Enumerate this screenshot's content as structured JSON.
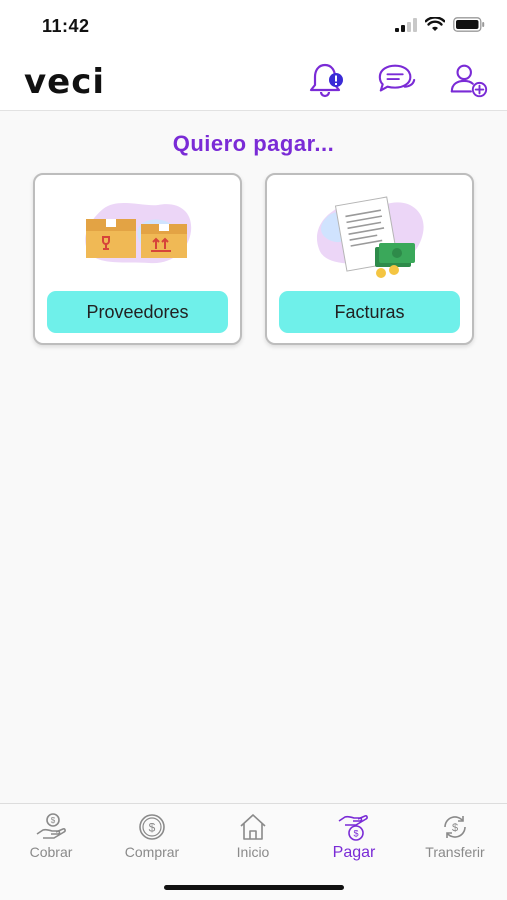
{
  "status_bar": {
    "time": "11:42"
  },
  "header": {
    "logo": "veci",
    "icons": [
      "bell-alert-icon",
      "chat-icon",
      "add-user-icon"
    ]
  },
  "main": {
    "title": "Quiero pagar...",
    "options": [
      {
        "label": "Proveedores",
        "icon": "boxes-illustration"
      },
      {
        "label": "Facturas",
        "icon": "invoice-money-illustration"
      }
    ]
  },
  "bottom_nav": {
    "items": [
      {
        "label": "Cobrar",
        "icon": "hand-coin-icon",
        "active": false
      },
      {
        "label": "Comprar",
        "icon": "coin-icon",
        "active": false
      },
      {
        "label": "Inicio",
        "icon": "home-icon",
        "active": false
      },
      {
        "label": "Pagar",
        "icon": "pay-hand-icon",
        "active": true
      },
      {
        "label": "Transferir",
        "icon": "transfer-coin-icon",
        "active": false
      }
    ]
  },
  "colors": {
    "accent": "#7a2bd6",
    "button": "#6ff0ea",
    "inactive": "#8a8a8a"
  }
}
